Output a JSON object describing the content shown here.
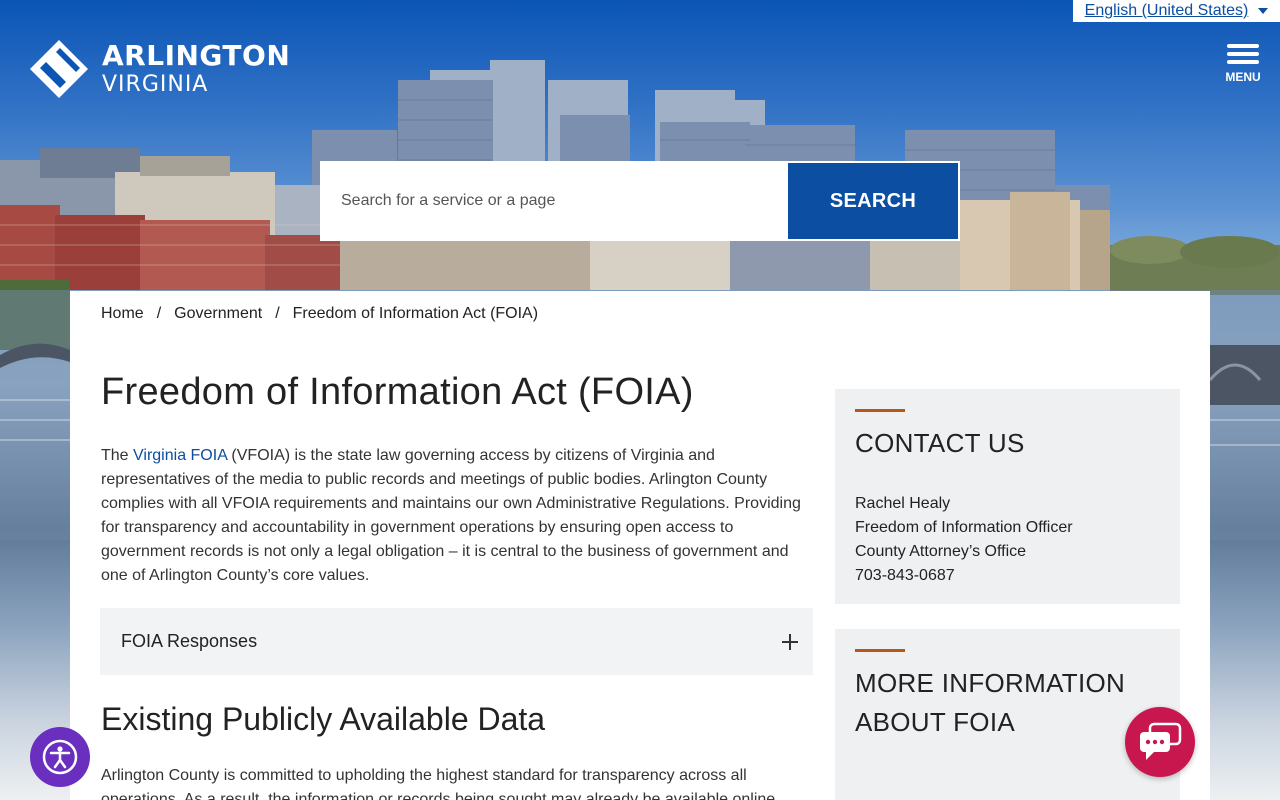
{
  "header": {
    "logo_name": "ARLINGTON",
    "logo_sub": "VIRGINIA",
    "language": "English (United States)",
    "menu_label": "MENU"
  },
  "search": {
    "placeholder": "Search for a service or a page",
    "button_label": "SEARCH"
  },
  "breadcrumb": [
    "Home",
    "Government",
    "Freedom of Information Act (FOIA)"
  ],
  "breadcrumb_separator": "/",
  "main": {
    "title": "Freedom of Information Act (FOIA)",
    "intro_prefix": "The ",
    "intro_link": "Virginia FOIA",
    "intro_rest": " (VFOIA) is the state law governing access by citizens of Virginia and representatives of the media to public records and meetings of public bodies.  Arlington County complies with all VFOIA requirements and maintains our own Administrative Regulations.  Providing for transparency and accountability in government operations by ensuring open access to government records is not only a legal obligation – it is central to the business of government and one of Arlington County’s core values.",
    "accordion_label": "FOIA Responses",
    "section_heading": "Existing Publicly Available Data",
    "section_body": "Arlington County is committed to upholding the highest standard for transparency across all operations.  As a result, the information or records being sought may already be available online"
  },
  "sidebar": {
    "contact_heading": "CONTACT US",
    "contact_lines": [
      "Rachel Healy",
      "Freedom of Information Officer",
      "County Attorney’s Office",
      "703-843-0687"
    ],
    "more_heading_line1": "MORE INFORMATION",
    "more_heading_line2": "ABOUT FOIA"
  },
  "colors": {
    "brand_blue": "#0b4ea2",
    "accent_rule": "#b5561b",
    "chat_button": "#c8174f",
    "accessibility_button": "#6b2fc0"
  },
  "icons": {
    "logo": "arlington-diamond-icon",
    "menu": "hamburger-icon",
    "language": "caret-down-icon",
    "accordion": "plus-icon",
    "accessibility": "accessibility-icon",
    "chat": "chat-icon"
  }
}
